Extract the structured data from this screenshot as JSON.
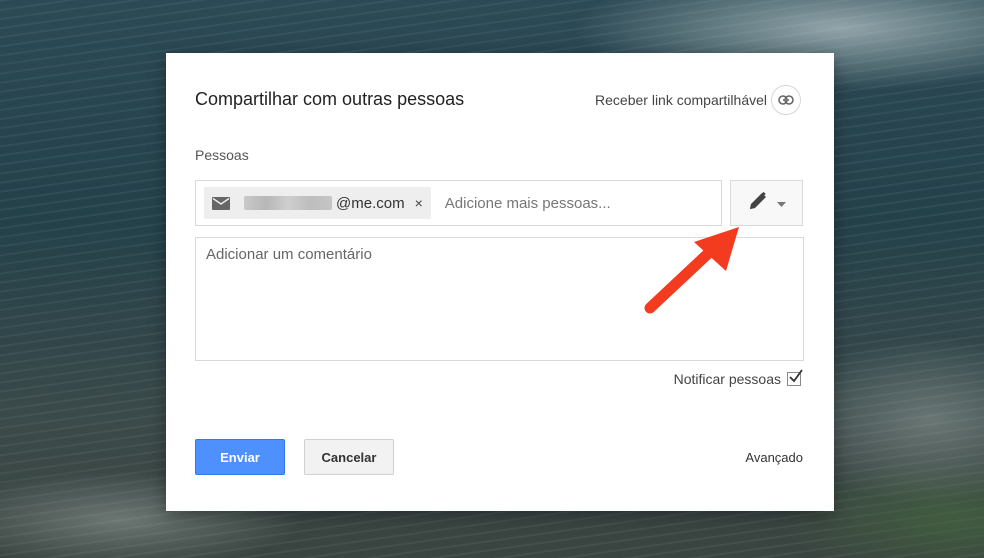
{
  "dialog": {
    "title": "Compartilhar com outras pessoas",
    "link_label": "Receber link compartilhável",
    "link_icon": "link-icon",
    "people_label": "Pessoas",
    "chip": {
      "icon": "mail-icon",
      "email_suffix": "@me.com",
      "remove_symbol": "×"
    },
    "add_people_placeholder": "Adicione mais pessoas...",
    "permission": {
      "icon": "pencil-icon",
      "dropdown_icon": "caret-down-icon"
    },
    "comment_placeholder": "Adicionar um comentário",
    "notify_label": "Notificar pessoas",
    "notify_checked": true,
    "send_label": "Enviar",
    "cancel_label": "Cancelar",
    "advanced_label": "Avançado"
  },
  "colors": {
    "send_button": "#4d90fe",
    "arrow": "#f23b1f"
  }
}
